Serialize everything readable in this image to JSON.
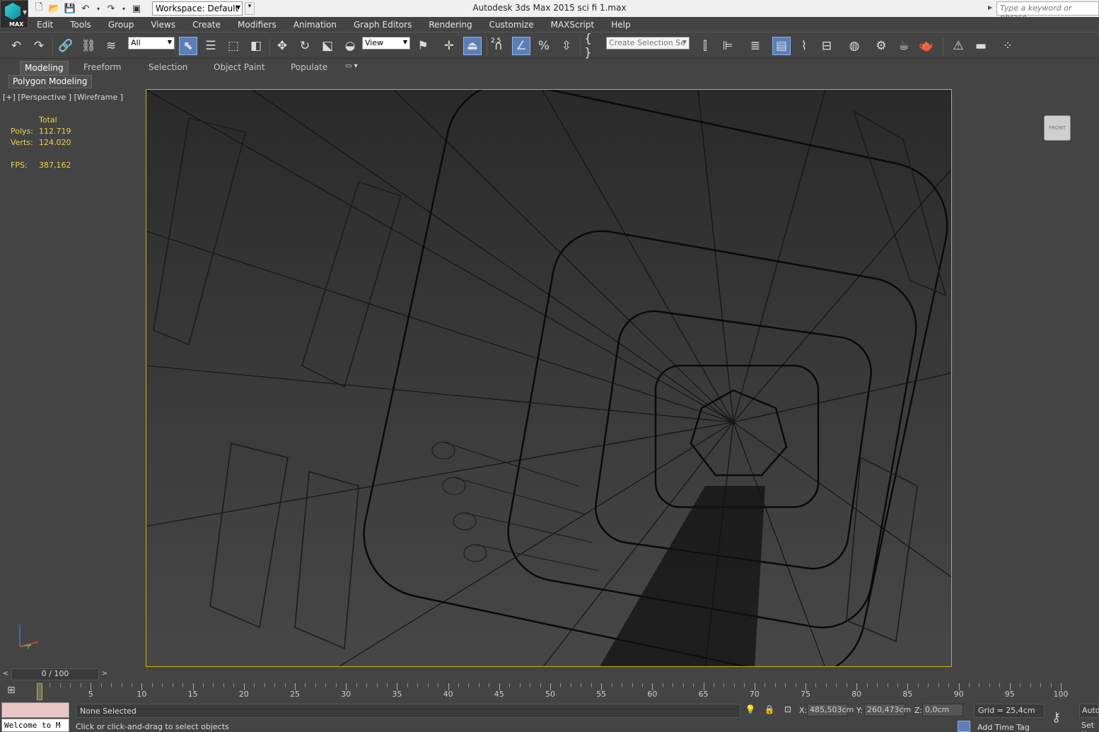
{
  "titlebar": {
    "logo_label": "MAX",
    "workspace": "Workspace: Default",
    "title": "Autodesk 3ds Max  2015      sci fi 1.max",
    "search_placeholder": "Type a keyword or phrase"
  },
  "menu": [
    "Edit",
    "Tools",
    "Group",
    "Views",
    "Create",
    "Modifiers",
    "Animation",
    "Graph Editors",
    "Rendering",
    "Customize",
    "MAXScript",
    "Help"
  ],
  "toolbar": {
    "selection_filter": "All",
    "reference_coord": "View",
    "named_selection": "Create Selection Se",
    "snap_label": "2.5"
  },
  "ribbon": {
    "tabs": [
      "Modeling",
      "Freeform",
      "Selection",
      "Object Paint",
      "Populate"
    ],
    "active_panel": "Polygon Modeling"
  },
  "viewport": {
    "label": "[+] [Perspective ] [Wireframe ]",
    "stats": {
      "header": "Total",
      "polys_label": "Polys:",
      "polys": "112.719",
      "verts_label": "Verts:",
      "verts": "124.020",
      "fps_label": "FPS:",
      "fps": "387,162"
    },
    "viewcube_label": "FRONT",
    "axis": {
      "z": "z",
      "y": "y",
      "x": "x"
    }
  },
  "timeline": {
    "current": "0 / 100",
    "ticks": [
      "0",
      "5",
      "10",
      "15",
      "20",
      "25",
      "30",
      "35",
      "40",
      "45",
      "50",
      "55",
      "60",
      "65",
      "70",
      "75",
      "80",
      "85",
      "90",
      "95",
      "100"
    ]
  },
  "status": {
    "listener": "Welcome to M",
    "selection": "None Selected",
    "prompt": "Click or click-and-drag to select objects",
    "x_label": "X:",
    "x": "485,503cm",
    "y_label": "Y:",
    "y": "260,473cm",
    "z_label": "Z:",
    "z": "0,0cm",
    "grid": "Grid = 25,4cm",
    "time_tag": "Add Time Tag",
    "auto": "Auto",
    "set_key": "Set K"
  },
  "colors": {
    "viewport_border": "#c8b400",
    "stats_text": "#e8d44a",
    "active_button": "#5a7fb8"
  }
}
